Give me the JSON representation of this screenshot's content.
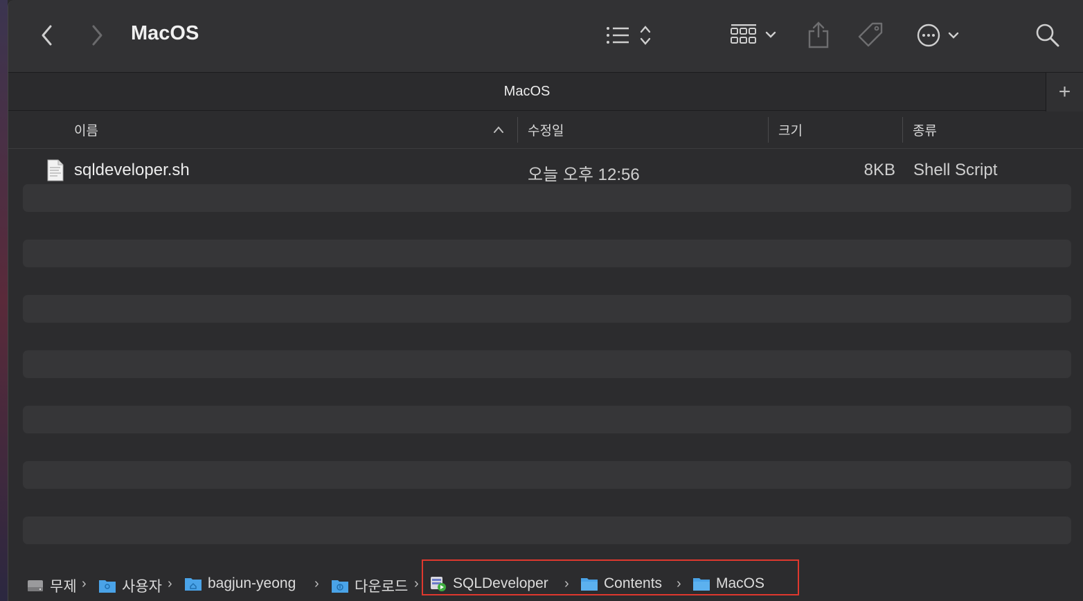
{
  "window": {
    "title": "MacOS",
    "tab_label": "MacOS",
    "tab_add": "+"
  },
  "toolbar": {
    "icons": [
      "back-chevron-icon",
      "forward-chevron-icon",
      "list-view-icon",
      "group-grid-icon",
      "share-icon",
      "tag-icon",
      "more-actions-icon",
      "search-icon"
    ]
  },
  "columns": {
    "name": "이름",
    "modified": "수정일",
    "size": "크기",
    "kind": "종류"
  },
  "files": [
    {
      "name": "sqldeveloper.sh",
      "modified": "오늘 오후 12:56",
      "size": "8KB",
      "kind": "Shell Script",
      "icon": "script-file-icon"
    }
  ],
  "path": [
    {
      "label": "무제",
      "icon": "disk-icon"
    },
    {
      "label": "사용자",
      "icon": "users-folder-icon"
    },
    {
      "label": "bagjun-yeong",
      "icon": "home-folder-icon"
    },
    {
      "label": "다운로드",
      "icon": "downloads-folder-icon"
    },
    {
      "label": "SQLDeveloper",
      "icon": "app-icon"
    },
    {
      "label": "Contents",
      "icon": "folder-icon"
    },
    {
      "label": "MacOS",
      "icon": "folder-icon"
    }
  ],
  "path_separator": "›",
  "colors": {
    "highlight": "#e0382e",
    "folder": "#4aa3e8",
    "window_bg": "#2c2c2e"
  }
}
